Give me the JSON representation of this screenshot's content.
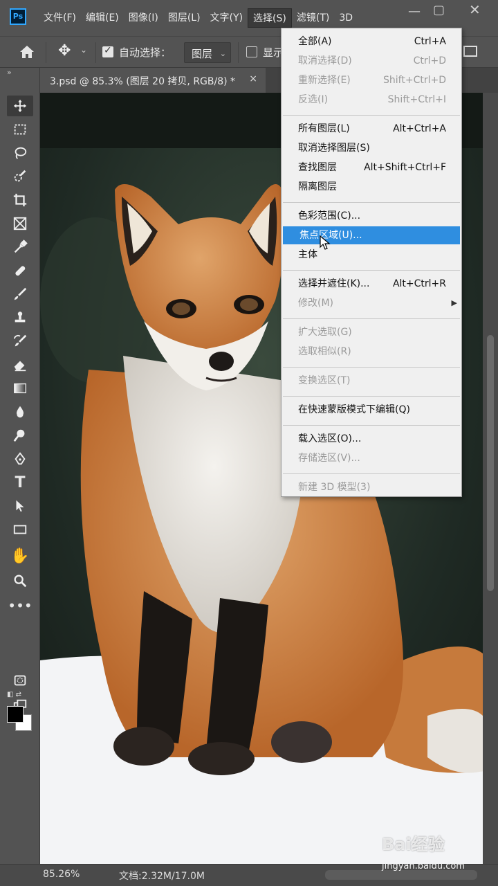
{
  "app": {
    "logo": "Ps"
  },
  "menubar": {
    "items": [
      "文件(F)",
      "编辑(E)",
      "图像(I)",
      "图层(L)",
      "文字(Y)",
      "选择(S)",
      "滤镜(T)",
      "3D"
    ],
    "active_index": 5,
    "window_controls": [
      "minimize-icon",
      "maximize-icon",
      "close-icon"
    ]
  },
  "options": {
    "auto_select_label": "自动选择：",
    "auto_select_checked": true,
    "auto_select_value": "图层",
    "show_label": "显示",
    "show_checked": false
  },
  "document_tab": {
    "title": "3.psd @ 85.3% (图层 20 拷贝, RGB/8) *",
    "close": "×"
  },
  "select_menu": {
    "groups": [
      [
        {
          "label": "全部(A)",
          "shortcut": "Ctrl+A",
          "enabled": true
        },
        {
          "label": "取消选择(D)",
          "shortcut": "Ctrl+D",
          "enabled": false
        },
        {
          "label": "重新选择(E)",
          "shortcut": "Shift+Ctrl+D",
          "enabled": false
        },
        {
          "label": "反选(I)",
          "shortcut": "Shift+Ctrl+I",
          "enabled": false
        }
      ],
      [
        {
          "label": "所有图层(L)",
          "shortcut": "Alt+Ctrl+A",
          "enabled": true
        },
        {
          "label": "取消选择图层(S)",
          "shortcut": "",
          "enabled": true
        },
        {
          "label": "查找图层",
          "shortcut": "Alt+Shift+Ctrl+F",
          "enabled": true
        },
        {
          "label": "隔离图层",
          "shortcut": "",
          "enabled": true
        }
      ],
      [
        {
          "label": "色彩范围(C)...",
          "shortcut": "",
          "enabled": true
        },
        {
          "label": "焦点区域(U)...",
          "shortcut": "",
          "enabled": true,
          "highlighted": true
        },
        {
          "label": "主体",
          "shortcut": "",
          "enabled": true
        }
      ],
      [
        {
          "label": "选择并遮住(K)...",
          "shortcut": "Alt+Ctrl+R",
          "enabled": true
        },
        {
          "label": "修改(M)",
          "shortcut": "",
          "enabled": false,
          "submenu": true
        }
      ],
      [
        {
          "label": "扩大选取(G)",
          "shortcut": "",
          "enabled": false
        },
        {
          "label": "选取相似(R)",
          "shortcut": "",
          "enabled": false
        }
      ],
      [
        {
          "label": "变换选区(T)",
          "shortcut": "",
          "enabled": false
        }
      ],
      [
        {
          "label": "在快速蒙版模式下编辑(Q)",
          "shortcut": "",
          "enabled": true
        }
      ],
      [
        {
          "label": "载入选区(O)...",
          "shortcut": "",
          "enabled": true
        },
        {
          "label": "存储选区(V)...",
          "shortcut": "",
          "enabled": false
        }
      ],
      [
        {
          "label": "新建 3D 模型(3)",
          "shortcut": "",
          "enabled": false
        }
      ]
    ]
  },
  "tools": [
    "move-tool",
    "marquee-tool",
    "lasso-tool",
    "quick-selection-tool",
    "crop-tool",
    "frame-tool",
    "eyedropper-tool",
    "healing-brush-tool",
    "brush-tool",
    "clone-stamp-tool",
    "history-brush-tool",
    "eraser-tool",
    "gradient-tool",
    "blur-tool",
    "dodge-tool",
    "pen-tool",
    "type-tool",
    "path-selection-tool",
    "rectangle-tool",
    "hand-tool",
    "zoom-tool",
    "more-tools"
  ],
  "colors": {
    "foreground": "#000000",
    "background": "#ffffff",
    "highlight": "#2f8ee0"
  },
  "status": {
    "zoom": "85.26%",
    "doc_info": "文档:2.32M/17.0M"
  },
  "watermark": {
    "brand": "Bai经验",
    "url": "jingyan.baidu.com"
  }
}
